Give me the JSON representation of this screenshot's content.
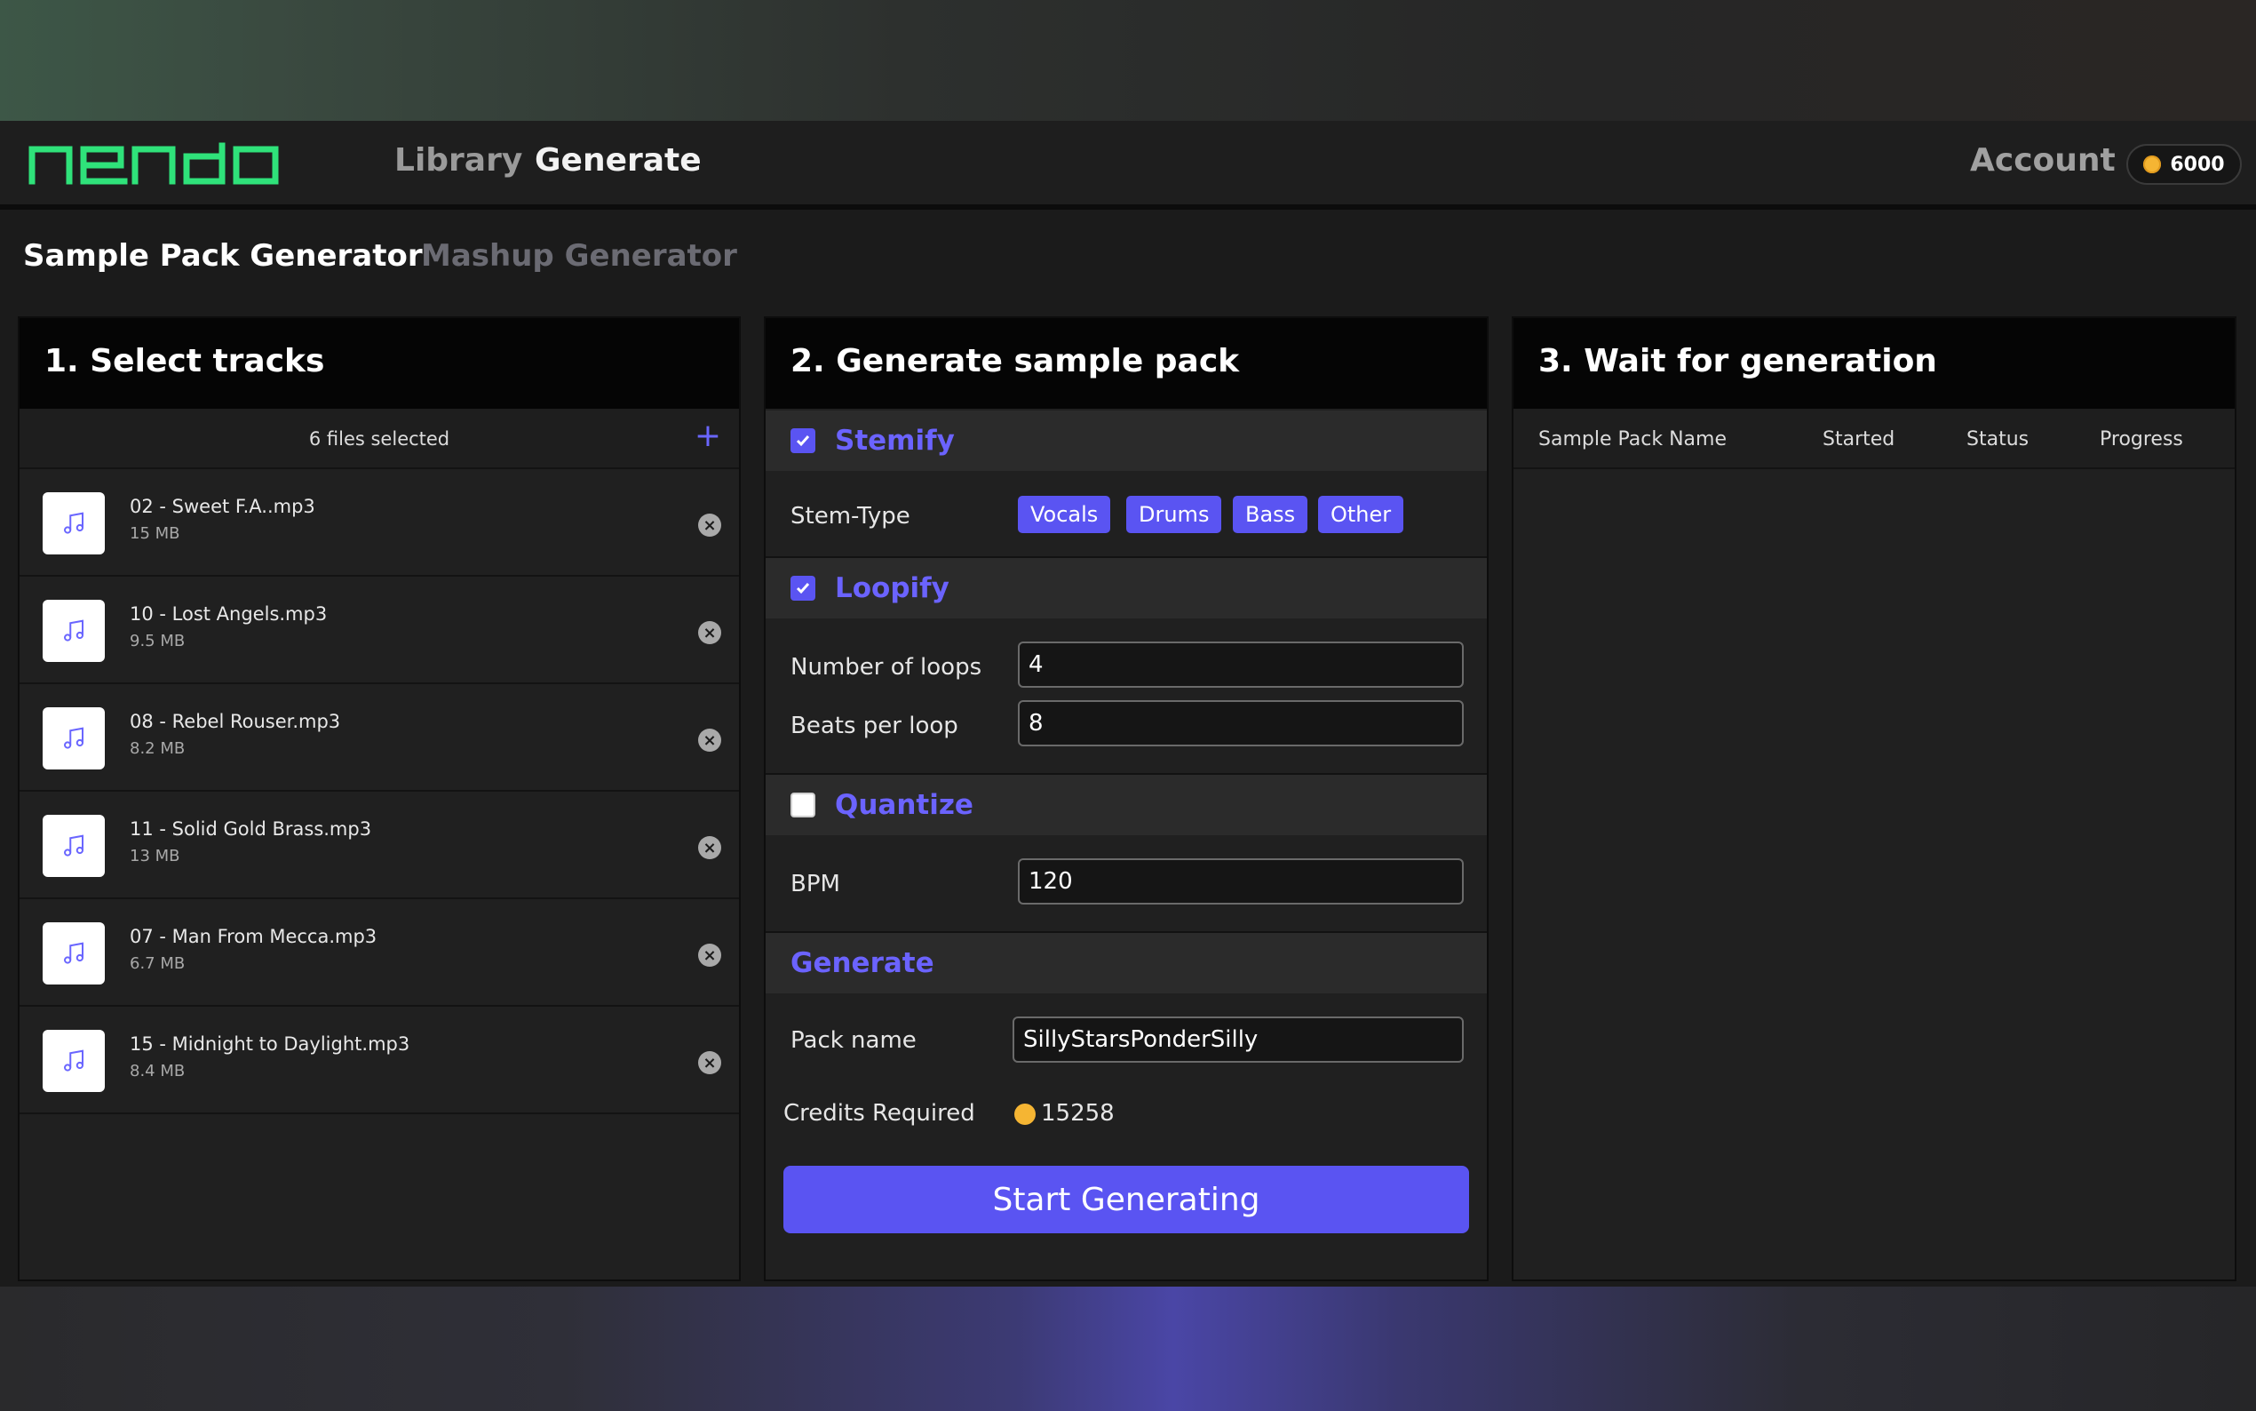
{
  "nav": {
    "logo_text": "nendo",
    "links": [
      "Library",
      "Generate"
    ],
    "account_label": "Account",
    "credits": "6000",
    "brand_color": "#2fe27a",
    "coin_color": "#f5b533"
  },
  "subtabs": {
    "active": "Sample Pack Generator",
    "inactive": "Mashup Generator"
  },
  "panel1": {
    "title": "1. Select tracks",
    "files_selected": "6 files selected",
    "add_icon": "plus-icon",
    "tracks": [
      {
        "name": "02 - Sweet F.A..mp3",
        "size": "15 MB"
      },
      {
        "name": "10 - Lost Angels.mp3",
        "size": "9.5 MB"
      },
      {
        "name": "08 - Rebel Rouser.mp3",
        "size": "8.2 MB"
      },
      {
        "name": "11 - Solid Gold Brass.mp3",
        "size": "13 MB"
      },
      {
        "name": "07 - Man From Mecca.mp3",
        "size": "6.7 MB"
      },
      {
        "name": "15 - Midnight to Daylight.mp3",
        "size": "8.4 MB"
      }
    ]
  },
  "panel2": {
    "title": "2. Generate sample pack",
    "stemify": {
      "label": "Stemify",
      "checked": true,
      "stem_type_label": "Stem-Type",
      "stems": [
        "Vocals",
        "Drums",
        "Bass",
        "Other"
      ]
    },
    "loopify": {
      "label": "Loopify",
      "checked": true,
      "num_loops_label": "Number of loops",
      "num_loops": "4",
      "beats_label": "Beats per loop",
      "beats": "8"
    },
    "quantize": {
      "label": "Quantize",
      "checked": false,
      "bpm_label": "BPM",
      "bpm": "120"
    },
    "generate": {
      "label": "Generate",
      "pack_name_label": "Pack name",
      "pack_name": "SillyStarsPonderSilly",
      "credits_label": "Credits Required",
      "credits_required": "15258",
      "button": "Start Generating"
    },
    "accent_color": "#5a54f2"
  },
  "panel3": {
    "title": "3. Wait for generation",
    "columns": [
      "Sample Pack Name",
      "Started",
      "Status",
      "Progress"
    ]
  }
}
